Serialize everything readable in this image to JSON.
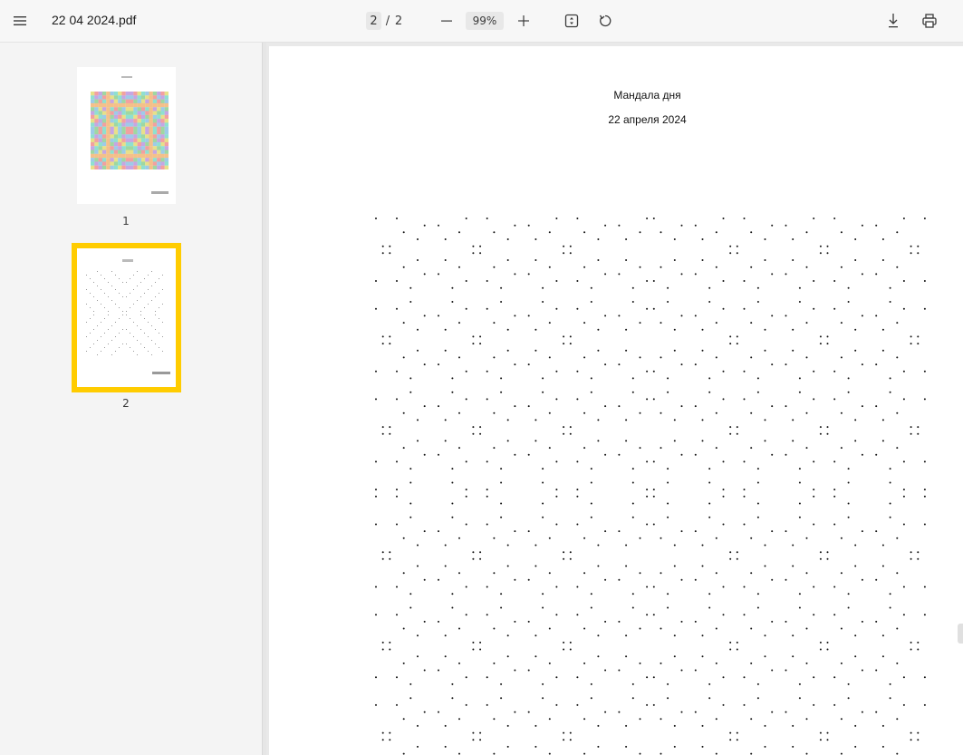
{
  "toolbar": {
    "title": "22 04 2024.pdf",
    "page_current": "2",
    "page_separator": "/",
    "page_total": "2",
    "zoom": "99%",
    "icons": [
      "menu-icon",
      "minus-icon",
      "plus-icon",
      "fit-page-icon",
      "rotate-icon",
      "download-icon",
      "print-icon"
    ]
  },
  "sidebar": {
    "thumbnails": [
      {
        "label": "1",
        "selected": false
      },
      {
        "label": "2",
        "selected": true
      }
    ],
    "selected_color": "#ffcc00"
  },
  "page": {
    "heading": "Мандала дня",
    "date": "22 апреля 2024"
  }
}
